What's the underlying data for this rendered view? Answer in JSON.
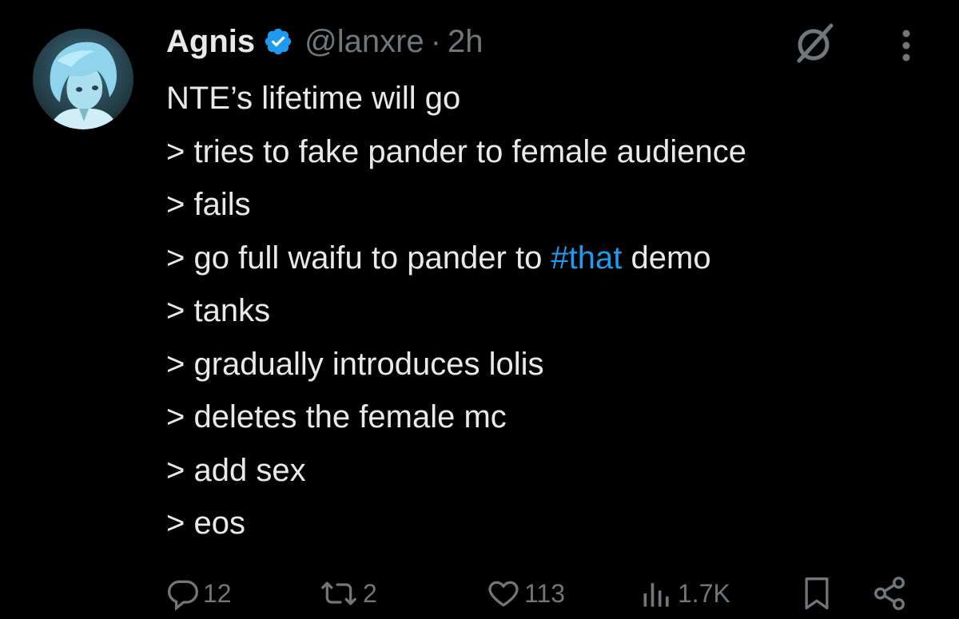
{
  "tweet": {
    "author": {
      "display_name": "Agnis",
      "handle": "@lanxre",
      "separator": "·",
      "time": "2h",
      "verified": true
    },
    "body": {
      "line1": "NTE’s lifetime will go",
      "line2": "> tries to fake pander to female audience",
      "line3": "> fails",
      "line4_pre": "> go full waifu to pander to ",
      "line4_hashtag": "#that",
      "line4_post": " demo",
      "line5": "> tanks",
      "line6": "> gradually introduces lolis",
      "line7": "> deletes the female mc",
      "line8": "> add sex",
      "line9": "> eos"
    },
    "actions": {
      "replies": "12",
      "reposts": "2",
      "likes": "113",
      "views": "1.7K"
    },
    "icons": {
      "header": [
        "grok-icon",
        "more-icon"
      ],
      "actions": [
        "reply-icon",
        "repost-icon",
        "like-icon",
        "views-icon",
        "bookmark-icon",
        "share-icon"
      ]
    }
  },
  "colors": {
    "background": "#000000",
    "text": "#e7e9ea",
    "muted": "#71767b",
    "accent": "#1d9bf0"
  }
}
